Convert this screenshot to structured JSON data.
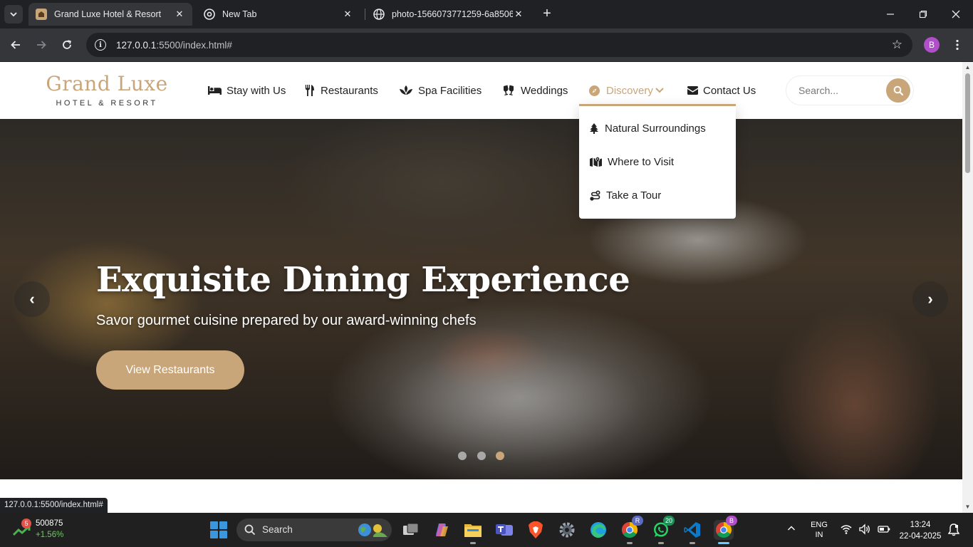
{
  "browser": {
    "tabs": [
      {
        "title": "Grand Luxe Hotel & Resort",
        "active": true
      },
      {
        "title": "New Tab",
        "active": false
      },
      {
        "title": "photo-1566073771259-6a8506",
        "active": false
      }
    ],
    "url_host": "127.0.0.1",
    "url_rest": ":5500/index.html#",
    "profile_initial": "B",
    "status_url": "127.0.0.1:5500/index.html#"
  },
  "site": {
    "logo_name": "Grand Luxe",
    "logo_tagline": "HOTEL & RESORT",
    "nav": [
      {
        "label": "Stay with Us",
        "icon": "bed-icon"
      },
      {
        "label": "Restaurants",
        "icon": "utensils-icon"
      },
      {
        "label": "Spa Facilities",
        "icon": "spa-lotus-icon"
      },
      {
        "label": "Weddings",
        "icon": "glasses-cheers-icon"
      },
      {
        "label": "Discovery",
        "icon": "compass-icon",
        "active": true
      },
      {
        "label": "Contact Us",
        "icon": "envelope-icon"
      }
    ],
    "search_placeholder": "Search...",
    "discovery_menu": [
      {
        "label": "Natural Surroundings",
        "icon": "tree-icon"
      },
      {
        "label": "Where to Visit",
        "icon": "map-location-icon"
      },
      {
        "label": "Take a Tour",
        "icon": "route-icon"
      }
    ],
    "hero": {
      "title": "Exquisite Dining Experience",
      "subtitle": "Savor gourmet cuisine prepared by our award-winning chefs",
      "button": "View Restaurants",
      "prev": "‹",
      "next": "›",
      "slide_count": 3,
      "active_slide": 3
    },
    "colors": {
      "accent": "#c9a57a",
      "text": "#222222"
    }
  },
  "taskbar": {
    "stock_badge": "5",
    "stock_value": "500875",
    "stock_change": "+1.56%",
    "search_label": "Search",
    "teams_badge": "",
    "chrome_r_badge": "R",
    "whatsapp_badge": "20",
    "chrome_b_badge": "B",
    "lang_line1": "ENG",
    "lang_line2": "IN",
    "time": "13:24",
    "date": "22-04-2025"
  }
}
